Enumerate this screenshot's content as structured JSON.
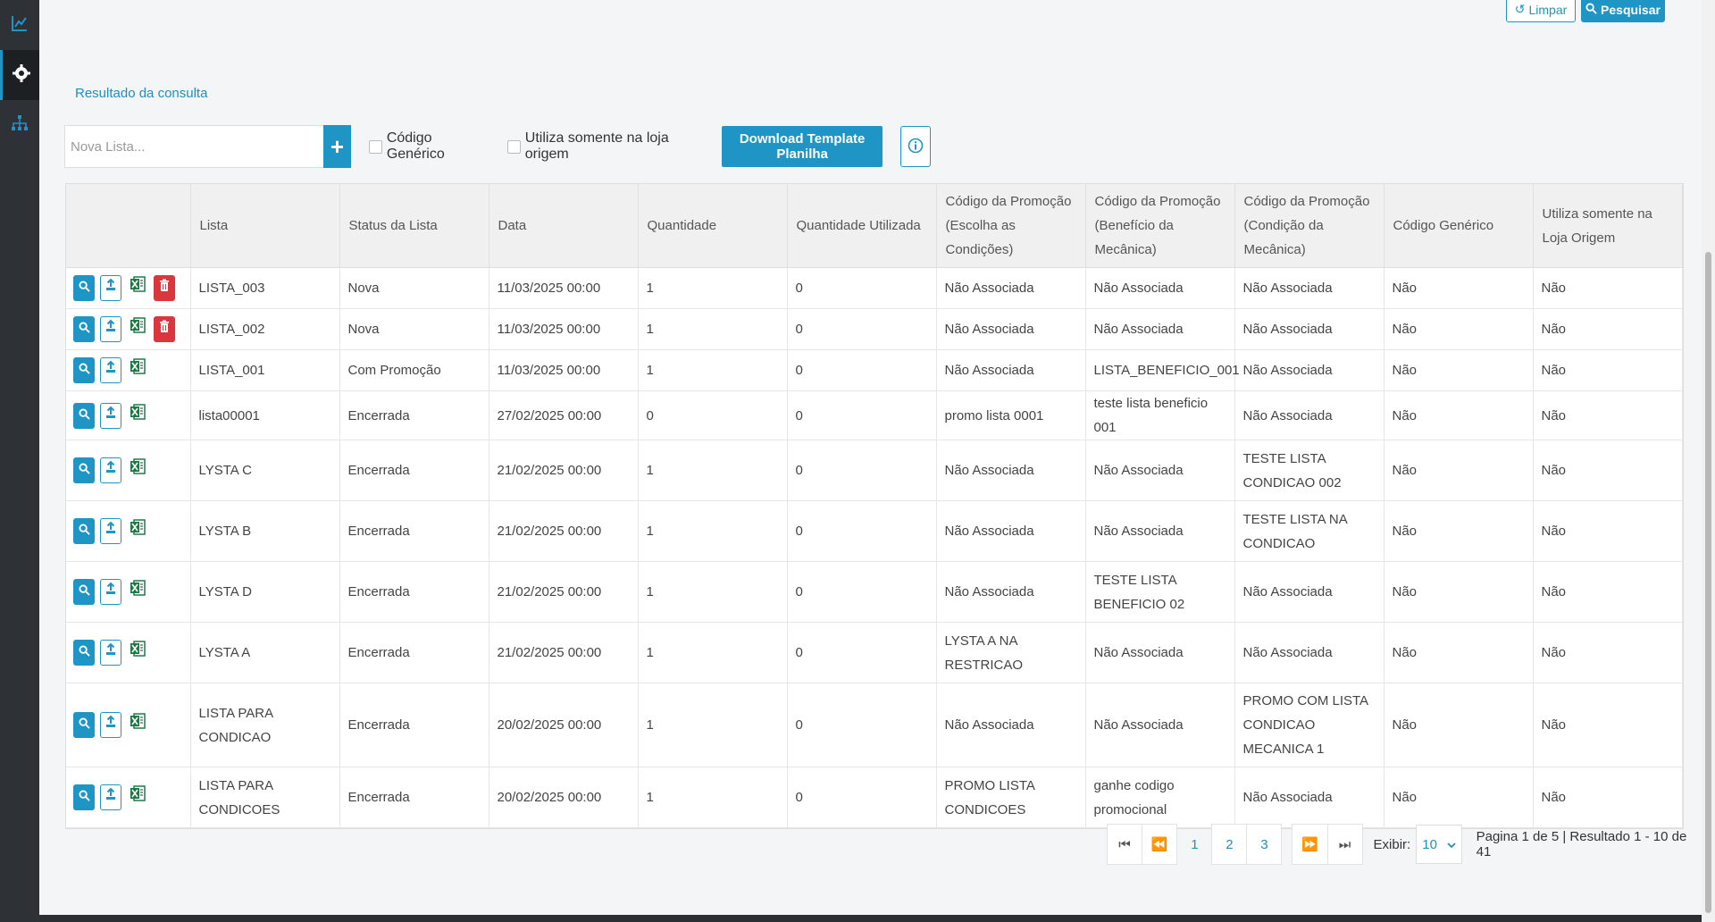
{
  "sidebar": {
    "items": [
      {
        "icon": "chart-line-icon"
      },
      {
        "icon": "gear-icon"
      },
      {
        "icon": "sitemap-icon"
      }
    ]
  },
  "top_actions": {
    "clear_label": "Limpar",
    "search_label": "Pesquisar"
  },
  "result_title": "Resultado da consulta",
  "toolbar": {
    "new_list_placeholder": "Nova Lista...",
    "add_label": "+",
    "generic_code_label": "Código Genérico",
    "origin_store_label": "Utiliza somente na loja origem",
    "download_label": "Download Template Planilha",
    "info_icon": "info-icon"
  },
  "table": {
    "headers": [
      "",
      "Lista",
      "Status da Lista",
      "Data",
      "Quantidade",
      "Quantidade Utilizada",
      "Código da Promoção (Escolha as Condições)",
      "Código da Promoção (Benefício da Mecânica)",
      "Código da Promoção (Condição da Mecânica)",
      "Código Genérico",
      "Utiliza somente na Loja Origem"
    ],
    "rows": [
      {
        "lista": "LISTA_003",
        "status": "Nova",
        "data": "11/03/2025 00:00",
        "quantidade": "1",
        "utilizada": "0",
        "promo_escolha": "Não Associada",
        "promo_beneficio": "Não Associada",
        "promo_condicao": "Não Associada",
        "generico": "Não",
        "origem": "Não",
        "deletable": true
      },
      {
        "lista": "LISTA_002",
        "status": "Nova",
        "data": "11/03/2025 00:00",
        "quantidade": "1",
        "utilizada": "0",
        "promo_escolha": "Não Associada",
        "promo_beneficio": "Não Associada",
        "promo_condicao": "Não Associada",
        "generico": "Não",
        "origem": "Não",
        "deletable": true
      },
      {
        "lista": "LISTA_001",
        "status": "Com Promoção",
        "data": "11/03/2025 00:00",
        "quantidade": "1",
        "utilizada": "0",
        "promo_escolha": "Não Associada",
        "promo_beneficio": "LISTA_BENEFICIO_001",
        "promo_condicao": "Não Associada",
        "generico": "Não",
        "origem": "Não",
        "deletable": false
      },
      {
        "lista": "lista00001",
        "status": "Encerrada",
        "data": "27/02/2025 00:00",
        "quantidade": "0",
        "utilizada": "0",
        "promo_escolha": "promo lista 0001",
        "promo_beneficio": "teste lista beneficio 001",
        "promo_condicao": "Não Associada",
        "generico": "Não",
        "origem": "Não",
        "deletable": false
      },
      {
        "lista": "LYSTA C",
        "status": "Encerrada",
        "data": "21/02/2025 00:00",
        "quantidade": "1",
        "utilizada": "0",
        "promo_escolha": "Não Associada",
        "promo_beneficio": "Não Associada",
        "promo_condicao": "TESTE LISTA CONDICAO 002",
        "generico": "Não",
        "origem": "Não",
        "deletable": false
      },
      {
        "lista": "LYSTA B",
        "status": "Encerrada",
        "data": "21/02/2025 00:00",
        "quantidade": "1",
        "utilizada": "0",
        "promo_escolha": "Não Associada",
        "promo_beneficio": "Não Associada",
        "promo_condicao": "TESTE LISTA NA CONDICAO",
        "generico": "Não",
        "origem": "Não",
        "deletable": false
      },
      {
        "lista": "LYSTA D",
        "status": "Encerrada",
        "data": "21/02/2025 00:00",
        "quantidade": "1",
        "utilizada": "0",
        "promo_escolha": "Não Associada",
        "promo_beneficio": "TESTE LISTA BENEFICIO 02",
        "promo_condicao": "Não Associada",
        "generico": "Não",
        "origem": "Não",
        "deletable": false
      },
      {
        "lista": "LYSTA A",
        "status": "Encerrada",
        "data": "21/02/2025 00:00",
        "quantidade": "1",
        "utilizada": "0",
        "promo_escolha": "LYSTA A NA RESTRICAO",
        "promo_beneficio": "Não Associada",
        "promo_condicao": "Não Associada",
        "generico": "Não",
        "origem": "Não",
        "deletable": false
      },
      {
        "lista": "LISTA PARA CONDICAO",
        "status": "Encerrada",
        "data": "20/02/2025 00:00",
        "quantidade": "1",
        "utilizada": "0",
        "promo_escolha": "Não Associada",
        "promo_beneficio": "Não Associada",
        "promo_condicao": "PROMO COM LISTA CONDICAO MECANICA 1",
        "generico": "Não",
        "origem": "Não",
        "deletable": false
      },
      {
        "lista": "LISTA PARA CONDICOES",
        "status": "Encerrada",
        "data": "20/02/2025 00:00",
        "quantidade": "1",
        "utilizada": "0",
        "promo_escolha": "PROMO LISTA CONDICOES",
        "promo_beneficio": "ganhe codigo promocional",
        "promo_condicao": "Não Associada",
        "generico": "Não",
        "origem": "Não",
        "deletable": false
      }
    ]
  },
  "pagination": {
    "pages": [
      "1",
      "2",
      "3"
    ],
    "current_page": "1",
    "show_label": "Exibir:",
    "per_page": "10",
    "info": "Pagina 1 de 5 | Resultado 1 - 10 de 41"
  },
  "colors": {
    "accent": "#1f95c6",
    "danger": "#d9363e",
    "excel": "#1d7a45"
  }
}
